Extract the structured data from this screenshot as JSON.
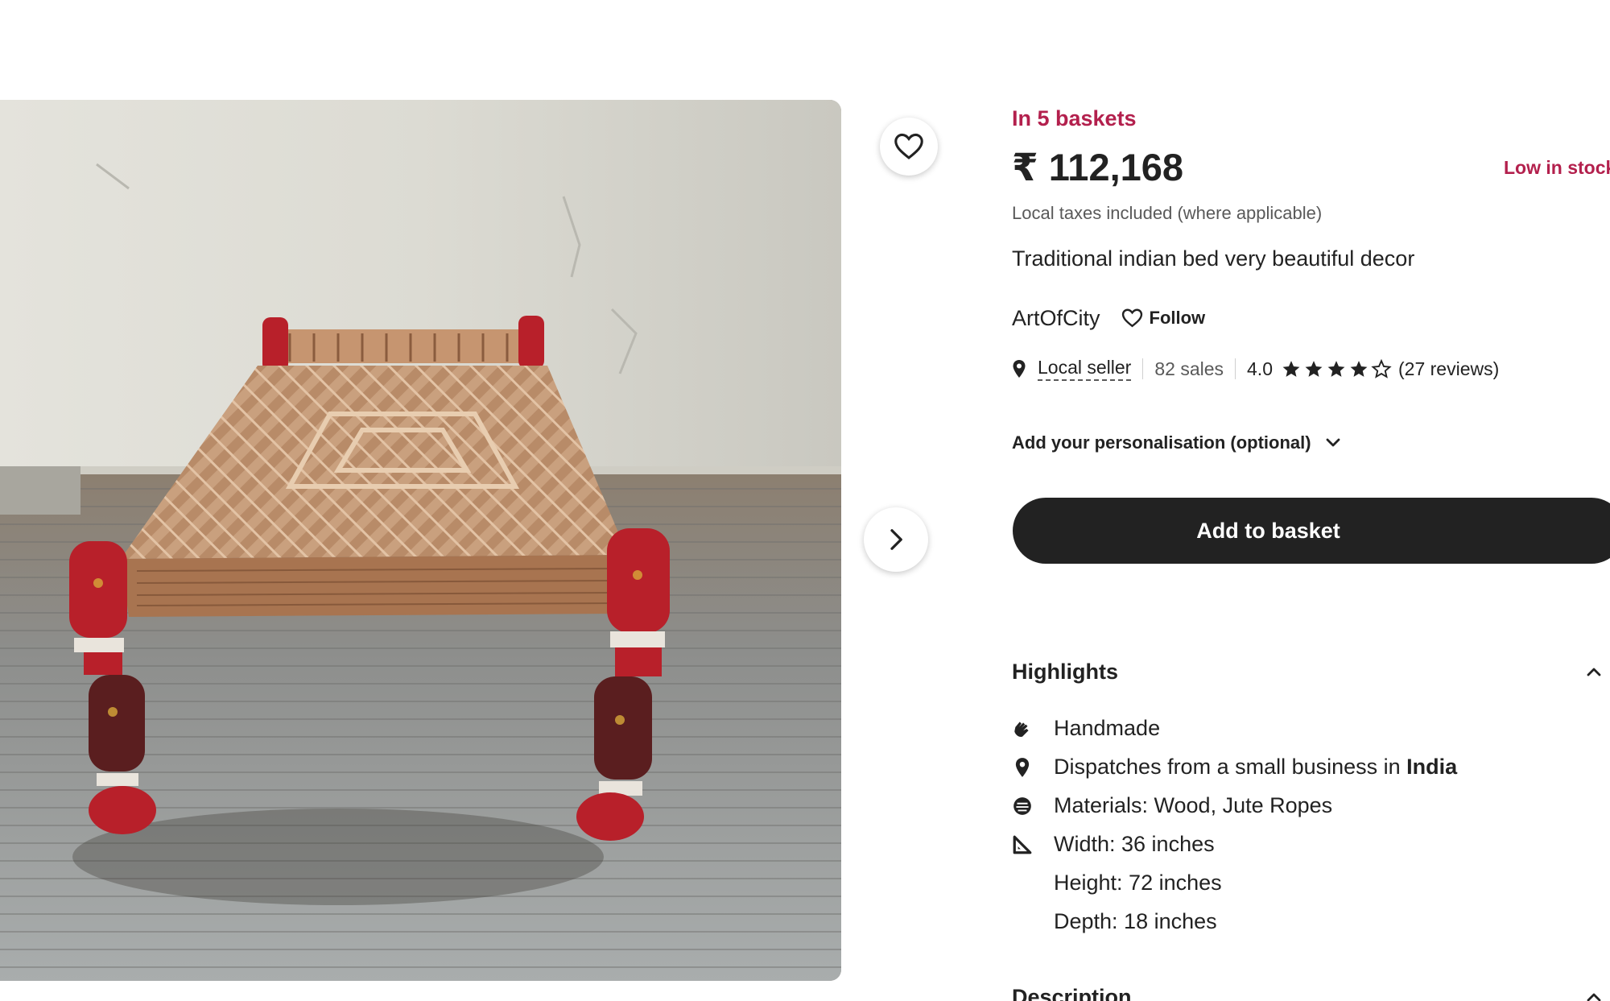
{
  "product": {
    "baskets_text": "In 5 baskets",
    "price": "₹ 112,168",
    "stock_status": "Low in stock",
    "taxes_note": "Local taxes included (where applicable)",
    "title": "Traditional indian bed very beautiful decor"
  },
  "shop": {
    "name": "ArtOfCity",
    "follow_label": "Follow",
    "local_seller_label": "Local seller",
    "sales": "82 sales",
    "rating": "4.0",
    "rating_value": 4,
    "rating_max": 5,
    "reviews": "(27 reviews)"
  },
  "personalisation": {
    "label": "Add your personalisation (optional)"
  },
  "actions": {
    "add_to_basket": "Add to basket"
  },
  "highlights": {
    "title": "Highlights",
    "items": {
      "handmade": "Handmade",
      "dispatch_prefix": "Dispatches from a small business in ",
      "dispatch_country": "India",
      "materials": "Materials: Wood, Jute Ropes",
      "width": "Width: 36 inches",
      "height": "Height: 72 inches",
      "depth": "Depth: 18 inches"
    }
  },
  "description": {
    "title": "Description"
  },
  "colors": {
    "accent_red": "#b3204d",
    "button_dark": "#222222",
    "muted_text": "#595959"
  },
  "icons": {
    "favorite": "heart-icon",
    "next": "chevron-right-icon",
    "location": "map-pin-icon",
    "handmade": "hand-icon",
    "materials": "materials-icon",
    "dimensions": "ruler-triangle-icon",
    "expand": "chevron-down-icon",
    "collapse": "chevron-up-icon"
  }
}
